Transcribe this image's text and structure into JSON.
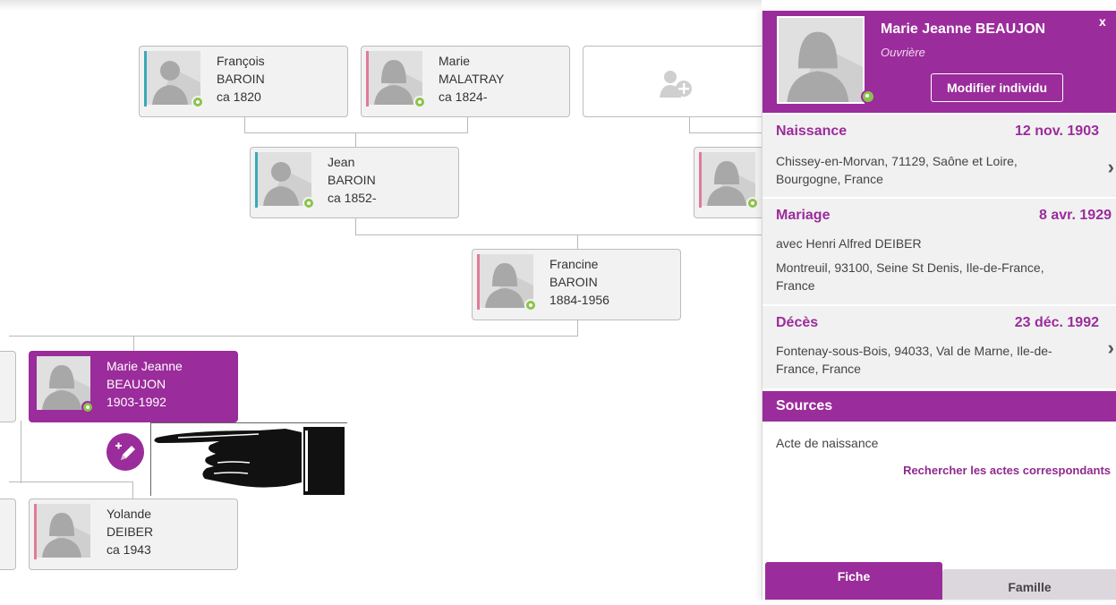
{
  "tree": {
    "grandparents": [
      {
        "first": "François",
        "last": "BAROIN",
        "dates": "ca 1820"
      },
      {
        "first": "Marie",
        "last": "MALATRAY",
        "dates": "ca 1824-"
      }
    ],
    "parent_baroin": {
      "first": "Jean",
      "last": "BAROIN",
      "dates": "ca 1852-"
    },
    "mother": {
      "first": "Francine",
      "last": "BAROIN",
      "dates": "1884-1956"
    },
    "selected": {
      "first": "Marie Jeanne",
      "last": "BEAUJON",
      "dates": "1903-1992"
    },
    "child": {
      "first": "Yolande",
      "last": "DEIBER",
      "dates": "ca 1943"
    }
  },
  "panel": {
    "name": "Marie Jeanne BEAUJON",
    "occupation": "Ouvrière",
    "close": "x",
    "modify_button": "Modifier individu",
    "events": {
      "birth": {
        "title": "Naissance",
        "date": "12 nov. 1903",
        "place1": "Chissey-en-Morvan, 71129, Saône et Loire,",
        "place2": "Bourgogne, France"
      },
      "marriage": {
        "title": "Mariage",
        "date": "8 avr. 1929",
        "spouse": "avec Henri Alfred DEIBER",
        "place1": "Montreuil, 93100, Seine St Denis, Ile-de-France,",
        "place2": "France"
      },
      "death": {
        "title": "Décès",
        "date": "23 déc. 1992",
        "place1": "Fontenay-sous-Bois, 94033, Val de Marne, Ile-de-",
        "place2": "France, France"
      }
    },
    "sources_title": "Sources",
    "source_item": "Acte de naissance",
    "source_link": "Rechercher les actes correspondants",
    "tabs": {
      "fiche": "Fiche",
      "famille": "Famille"
    }
  },
  "colors": {
    "accent": "#9b2c9b",
    "male": "#3aa9b8",
    "female": "#e07b98",
    "badge": "#8bc34a"
  }
}
